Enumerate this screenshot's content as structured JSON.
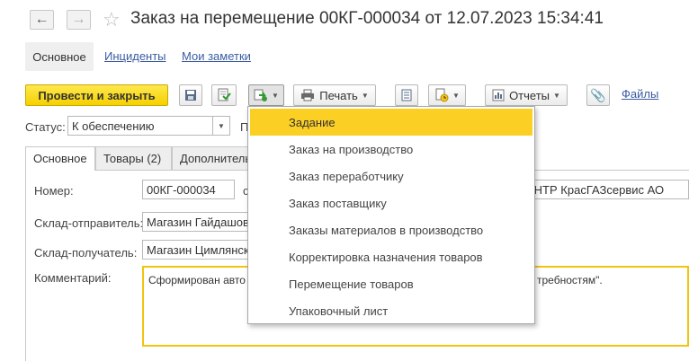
{
  "window": {
    "title": "Заказ на перемещение 00КГ-000034 от 12.07.2023 15:34:41"
  },
  "sections": {
    "active": "Основное",
    "links": [
      "Инциденты",
      "Мои заметки"
    ]
  },
  "toolbar": {
    "post_close": "Провести и закрыть",
    "print": "Печать",
    "reports": "Отчеты",
    "files": "Файлы"
  },
  "status": {
    "label": "Статус:",
    "value": "К обеспечению",
    "next_label_fragment": "П"
  },
  "tabs": [
    "Основное",
    "Товары (2)",
    "Дополнительно"
  ],
  "form": {
    "number_label": "Номер:",
    "number_value": "00КГ-000034",
    "org_label_fragment": "с",
    "org_value_fragment": "ЕНТР КрасГАЗсервис АО",
    "sender_label": "Склад-отправитель:",
    "sender_value": "Магазин Гайдашов",
    "receiver_label": "Склад-получатель:",
    "receiver_value": "Магазин Цимлянск",
    "comment_label": "Комментарий:",
    "comment_left": "Сформирован авто",
    "comment_right": "требностям\"."
  },
  "menu": {
    "items": [
      "Задание",
      "Заказ на производство",
      "Заказ переработчику",
      "Заказ поставщику",
      "Заказы материалов в производство",
      "Корректировка назначения товаров",
      "Перемещение товаров",
      "Упаковочный лист"
    ],
    "highlighted_index": 0
  },
  "colors": {
    "accent_yellow": "#f5d000",
    "highlight": "#fccf25",
    "link": "#3b5ba0",
    "focus_border": "#f1c40f"
  }
}
